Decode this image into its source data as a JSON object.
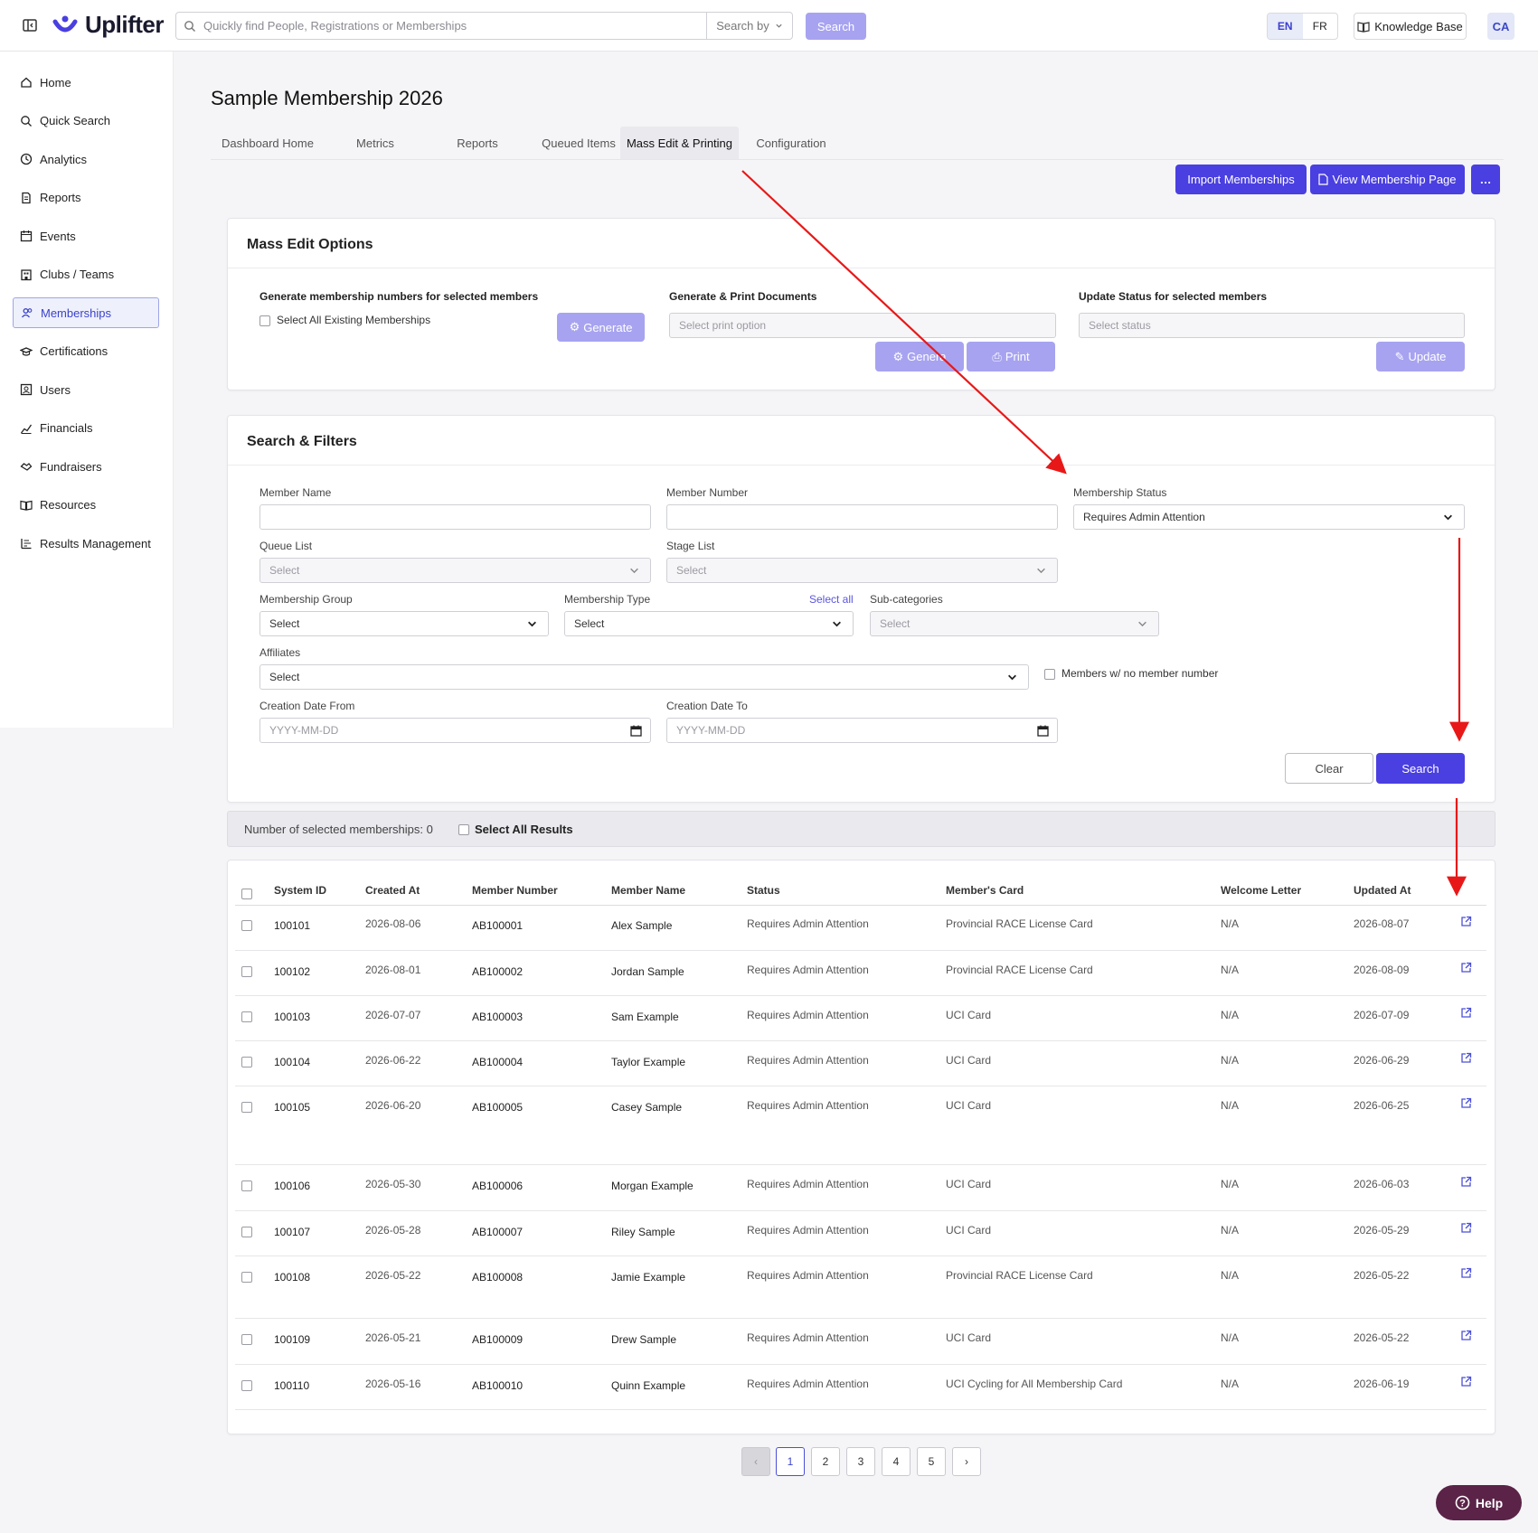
{
  "header": {
    "logo_text": "Uplifter",
    "search_placeholder": "Quickly find People, Registrations or Memberships",
    "search_by_label": "Search by",
    "search_button": "Search",
    "lang_en": "EN",
    "lang_fr": "FR",
    "knowledge_base": "Knowledge Base",
    "avatar_initials": "CA"
  },
  "sidebar": {
    "items": [
      {
        "label": "Home",
        "icon": "home-icon"
      },
      {
        "label": "Quick Search",
        "icon": "search-icon"
      },
      {
        "label": "Analytics",
        "icon": "clock-icon"
      },
      {
        "label": "Reports",
        "icon": "document-icon"
      },
      {
        "label": "Events",
        "icon": "calendar-icon"
      },
      {
        "label": "Clubs / Teams",
        "icon": "building-icon"
      },
      {
        "label": "Memberships",
        "icon": "users-icon",
        "active": true
      },
      {
        "label": "Certifications",
        "icon": "graduation-cap-icon"
      },
      {
        "label": "Users",
        "icon": "user-card-icon"
      },
      {
        "label": "Financials",
        "icon": "chart-icon"
      },
      {
        "label": "Fundraisers",
        "icon": "handshake-icon"
      },
      {
        "label": "Resources",
        "icon": "book-icon"
      },
      {
        "label": "Results Management",
        "icon": "list-icon"
      }
    ]
  },
  "page": {
    "title": "Sample Membership 2026",
    "tabs": [
      "Dashboard Home",
      "Metrics",
      "Reports",
      "Queued Items",
      "Mass Edit & Printing",
      "Configuration"
    ],
    "active_tab": "Mass Edit & Printing",
    "import_button": "Import Memberships",
    "view_page_button": "View Membership Page",
    "more_button": "…"
  },
  "mass_edit": {
    "title": "Mass Edit Options",
    "generate_numbers_label": "Generate membership numbers for selected members",
    "select_all_existing": "Select All Existing Memberships",
    "generate_button": "Generate",
    "print_docs_label": "Generate & Print Documents",
    "print_option_placeholder": "Select print option",
    "generate_doc_button": "Genera",
    "print_button": "Print",
    "update_status_label": "Update Status for selected members",
    "status_placeholder": "Select status",
    "update_button": "Update"
  },
  "filters": {
    "title": "Search & Filters",
    "member_name_label": "Member Name",
    "member_name_value": "",
    "member_number_label": "Member Number",
    "member_number_value": "",
    "status_label": "Membership Status",
    "status_value": "Requires Admin Attention",
    "queue_label": "Queue List",
    "queue_value": "Select",
    "stage_label": "Stage List",
    "stage_value": "Select",
    "group_label": "Membership Group",
    "group_value": "Select",
    "type_label": "Membership Type",
    "type_value": "Select",
    "type_select_all": "Select all",
    "subcat_label": "Sub-categories",
    "subcat_value": "Select",
    "affiliates_label": "Affiliates",
    "affiliates_value": "Select",
    "no_number_label": "Members w/ no member number",
    "date_from_label": "Creation Date From",
    "date_from_placeholder": "YYYY-MM-DD",
    "date_to_label": "Creation Date To",
    "date_to_placeholder": "YYYY-MM-DD",
    "clear_button": "Clear",
    "search_button": "Search"
  },
  "selection": {
    "count_text": "Number of selected memberships: 0",
    "select_all_results": "Select All Results"
  },
  "table": {
    "columns": [
      "System ID",
      "Created At",
      "Member Number",
      "Member Name",
      "Status",
      "Member's Card",
      "Welcome Letter",
      "Updated At"
    ],
    "rows": [
      {
        "id": "100101",
        "created": "2026-08-06",
        "number": "AB100001",
        "name": "Alex Sample",
        "status": "Requires Admin Attention",
        "card": "Provincial RACE License Card",
        "letter": "N/A",
        "updated": "2026-08-07"
      },
      {
        "id": "100102",
        "created": "2026-08-01",
        "number": "AB100002",
        "name": "Jordan Sample",
        "status": "Requires Admin Attention",
        "card": "Provincial RACE License Card",
        "letter": "N/A",
        "updated": "2026-08-09"
      },
      {
        "id": "100103",
        "created": "2026-07-07",
        "number": "AB100003",
        "name": "Sam Example",
        "status": "Requires Admin Attention",
        "card": "UCI Card",
        "letter": "N/A",
        "updated": "2026-07-09"
      },
      {
        "id": "100104",
        "created": "2026-06-22",
        "number": "AB100004",
        "name": "Taylor Example",
        "status": "Requires Admin Attention",
        "card": "UCI Card",
        "letter": "N/A",
        "updated": "2026-06-29"
      },
      {
        "id": "100105",
        "created": "2026-06-20",
        "number": "AB100005",
        "name": "Casey Sample",
        "status": "Requires Admin Attention",
        "card": "UCI Card",
        "letter": "N/A",
        "updated": "2026-06-25"
      },
      {
        "id": "100106",
        "created": "2026-05-30",
        "number": "AB100006",
        "name": "Morgan Example",
        "status": "Requires Admin Attention",
        "card": "UCI Card",
        "letter": "N/A",
        "updated": "2026-06-03"
      },
      {
        "id": "100107",
        "created": "2026-05-28",
        "number": "AB100007",
        "name": "Riley Sample",
        "status": "Requires Admin Attention",
        "card": "UCI Card",
        "letter": "N/A",
        "updated": "2026-05-29"
      },
      {
        "id": "100108",
        "created": "2026-05-22",
        "number": "AB100008",
        "name": "Jamie Example",
        "status": "Requires Admin Attention",
        "card": "Provincial RACE License Card",
        "letter": "N/A",
        "updated": "2026-05-22"
      },
      {
        "id": "100109",
        "created": "2026-05-21",
        "number": "AB100009",
        "name": "Drew Sample",
        "status": "Requires Admin Attention",
        "card": "UCI Card",
        "letter": "N/A",
        "updated": "2026-05-22"
      },
      {
        "id": "100110",
        "created": "2026-05-16",
        "number": "AB100010",
        "name": "Quinn Example",
        "status": "Requires Admin Attention",
        "card": "UCI Cycling for All Membership Card",
        "letter": "N/A",
        "updated": "2026-06-19"
      }
    ]
  },
  "pagination": {
    "prev": "‹",
    "pages": [
      "1",
      "2",
      "3",
      "4",
      "5"
    ],
    "current": "1",
    "next": "›"
  },
  "help_button": "Help",
  "colors": {
    "accent": "#4a3fe0",
    "accent_disabled": "#a7a3f0",
    "annotation_arrow": "#e81818",
    "help": "#5a2347"
  }
}
